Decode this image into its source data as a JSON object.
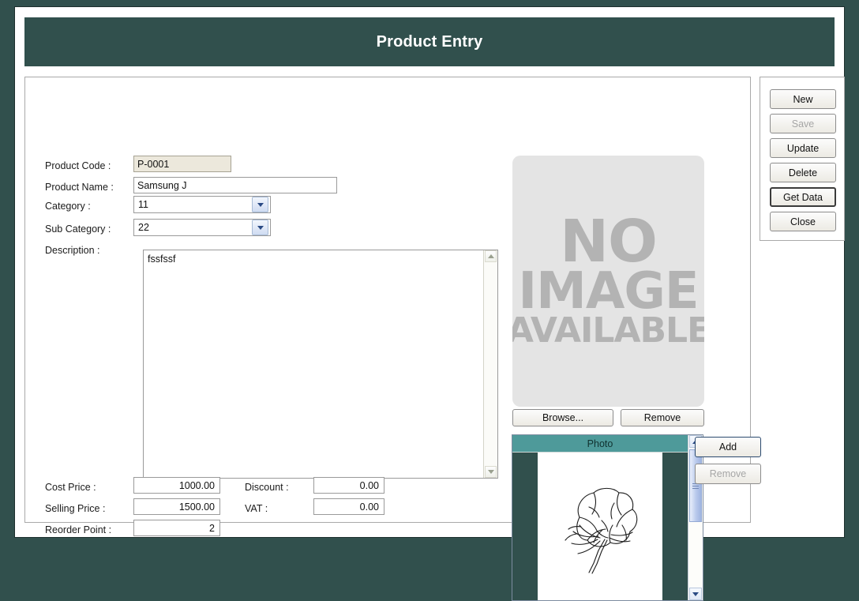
{
  "window": {
    "title": "Product Entry"
  },
  "form": {
    "product_code": {
      "label": "Product Code :",
      "value": "P-0001"
    },
    "product_name": {
      "label": "Product Name :",
      "value": "Samsung J"
    },
    "category": {
      "label": "Category :",
      "value": "11"
    },
    "sub_category": {
      "label": "Sub Category :",
      "value": "22"
    },
    "description": {
      "label": "Description :",
      "value": "fssfssf"
    },
    "cost_price": {
      "label": "Cost Price :",
      "value": "1000.00"
    },
    "selling_price": {
      "label": "Selling Price :",
      "value": "1500.00"
    },
    "reorder_point": {
      "label": "Reorder Point :",
      "value": "2"
    },
    "discount": {
      "label": "Discount :",
      "value": "0.00"
    },
    "vat": {
      "label": "VAT :",
      "value": "0.00"
    }
  },
  "image_panel": {
    "placeholder_line1": "NO",
    "placeholder_line2": "IMAGE",
    "placeholder_line3": "AVAILABLE",
    "browse_label": "Browse...",
    "remove_label": "Remove"
  },
  "photo_grid": {
    "column_header": "Photo",
    "add_label": "Add",
    "remove_label": "Remove"
  },
  "actions": {
    "new_label": "New",
    "save_label": "Save",
    "update_label": "Update",
    "delete_label": "Delete",
    "get_data_label": "Get Data",
    "close_label": "Close"
  },
  "colors": {
    "title_bar": "#31504d",
    "grid_header": "#4e9a9a",
    "readonly_field": "#ece8dc",
    "placeholder_text": "#b3b3b3"
  }
}
